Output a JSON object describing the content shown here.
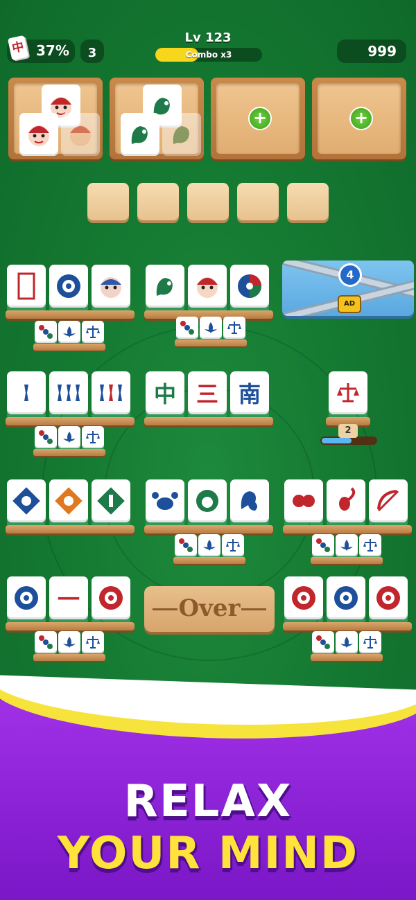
{
  "hud": {
    "progress_percent": "37%",
    "progress_icon_char": "中",
    "moves_count": "3",
    "level": "Lv 123",
    "combo": "Combo x3",
    "combo_fill": 0.4,
    "score": "999"
  },
  "tiles_text": {
    "zhong": "中",
    "san": "三",
    "nan": "南",
    "yi": "一"
  },
  "locked": {
    "unlock_count": "4",
    "ad_label": "AD"
  },
  "single": {
    "stack_count": "2",
    "fill": 0.55
  },
  "over_label": "Over",
  "banner": {
    "line1": "RELAX",
    "line2": "YOUR MIND"
  },
  "colors": {
    "felt": "#157a32",
    "tile_base": "#2f9a5a",
    "banner": "#8a20d6",
    "accent": "#ffe23a"
  }
}
